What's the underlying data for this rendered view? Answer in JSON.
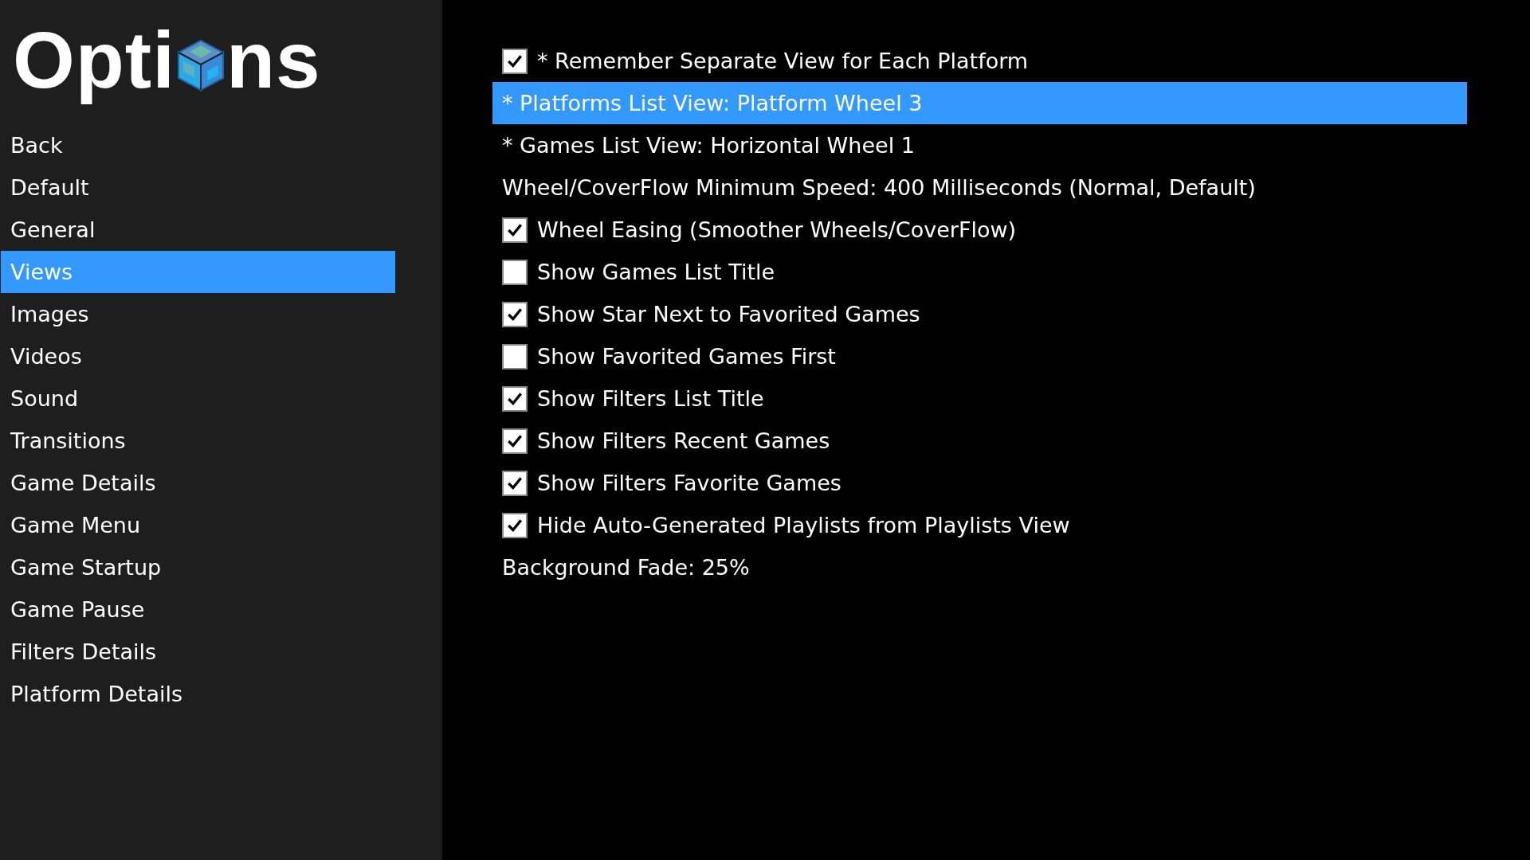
{
  "logo": {
    "text_before": "Opti",
    "text_after": "ns"
  },
  "sidebar": {
    "items": [
      {
        "label": "Back",
        "selected": false
      },
      {
        "label": "Default",
        "selected": false
      },
      {
        "label": "General",
        "selected": false
      },
      {
        "label": "Views",
        "selected": true
      },
      {
        "label": "Images",
        "selected": false
      },
      {
        "label": "Videos",
        "selected": false
      },
      {
        "label": "Sound",
        "selected": false
      },
      {
        "label": "Transitions",
        "selected": false
      },
      {
        "label": "Game Details",
        "selected": false
      },
      {
        "label": "Game Menu",
        "selected": false
      },
      {
        "label": "Game Startup",
        "selected": false
      },
      {
        "label": "Game Pause",
        "selected": false
      },
      {
        "label": "Filters Details",
        "selected": false
      },
      {
        "label": "Platform Details",
        "selected": false
      }
    ]
  },
  "options": [
    {
      "kind": "checkbox",
      "label": "* Remember Separate View for Each Platform",
      "checked": true,
      "selected": false
    },
    {
      "kind": "text",
      "label": "* Platforms List View: Platform Wheel 3",
      "selected": true
    },
    {
      "kind": "text",
      "label": "* Games List View: Horizontal Wheel 1",
      "selected": false
    },
    {
      "kind": "text",
      "label": "Wheel/CoverFlow Minimum Speed: 400 Milliseconds (Normal, Default)",
      "selected": false
    },
    {
      "kind": "checkbox",
      "label": "Wheel Easing (Smoother Wheels/CoverFlow)",
      "checked": true,
      "selected": false
    },
    {
      "kind": "checkbox",
      "label": "Show Games List Title",
      "checked": false,
      "selected": false
    },
    {
      "kind": "checkbox",
      "label": "Show Star Next to Favorited Games",
      "checked": true,
      "selected": false
    },
    {
      "kind": "checkbox",
      "label": "Show Favorited Games First",
      "checked": false,
      "selected": false
    },
    {
      "kind": "checkbox",
      "label": "Show Filters List Title",
      "checked": true,
      "selected": false
    },
    {
      "kind": "checkbox",
      "label": "Show Filters Recent Games",
      "checked": true,
      "selected": false
    },
    {
      "kind": "checkbox",
      "label": "Show Filters Favorite Games",
      "checked": true,
      "selected": false
    },
    {
      "kind": "checkbox",
      "label": "Hide Auto-Generated Playlists from Playlists View",
      "checked": true,
      "selected": false
    },
    {
      "kind": "text",
      "label": "Background Fade: 25%",
      "selected": false
    }
  ]
}
